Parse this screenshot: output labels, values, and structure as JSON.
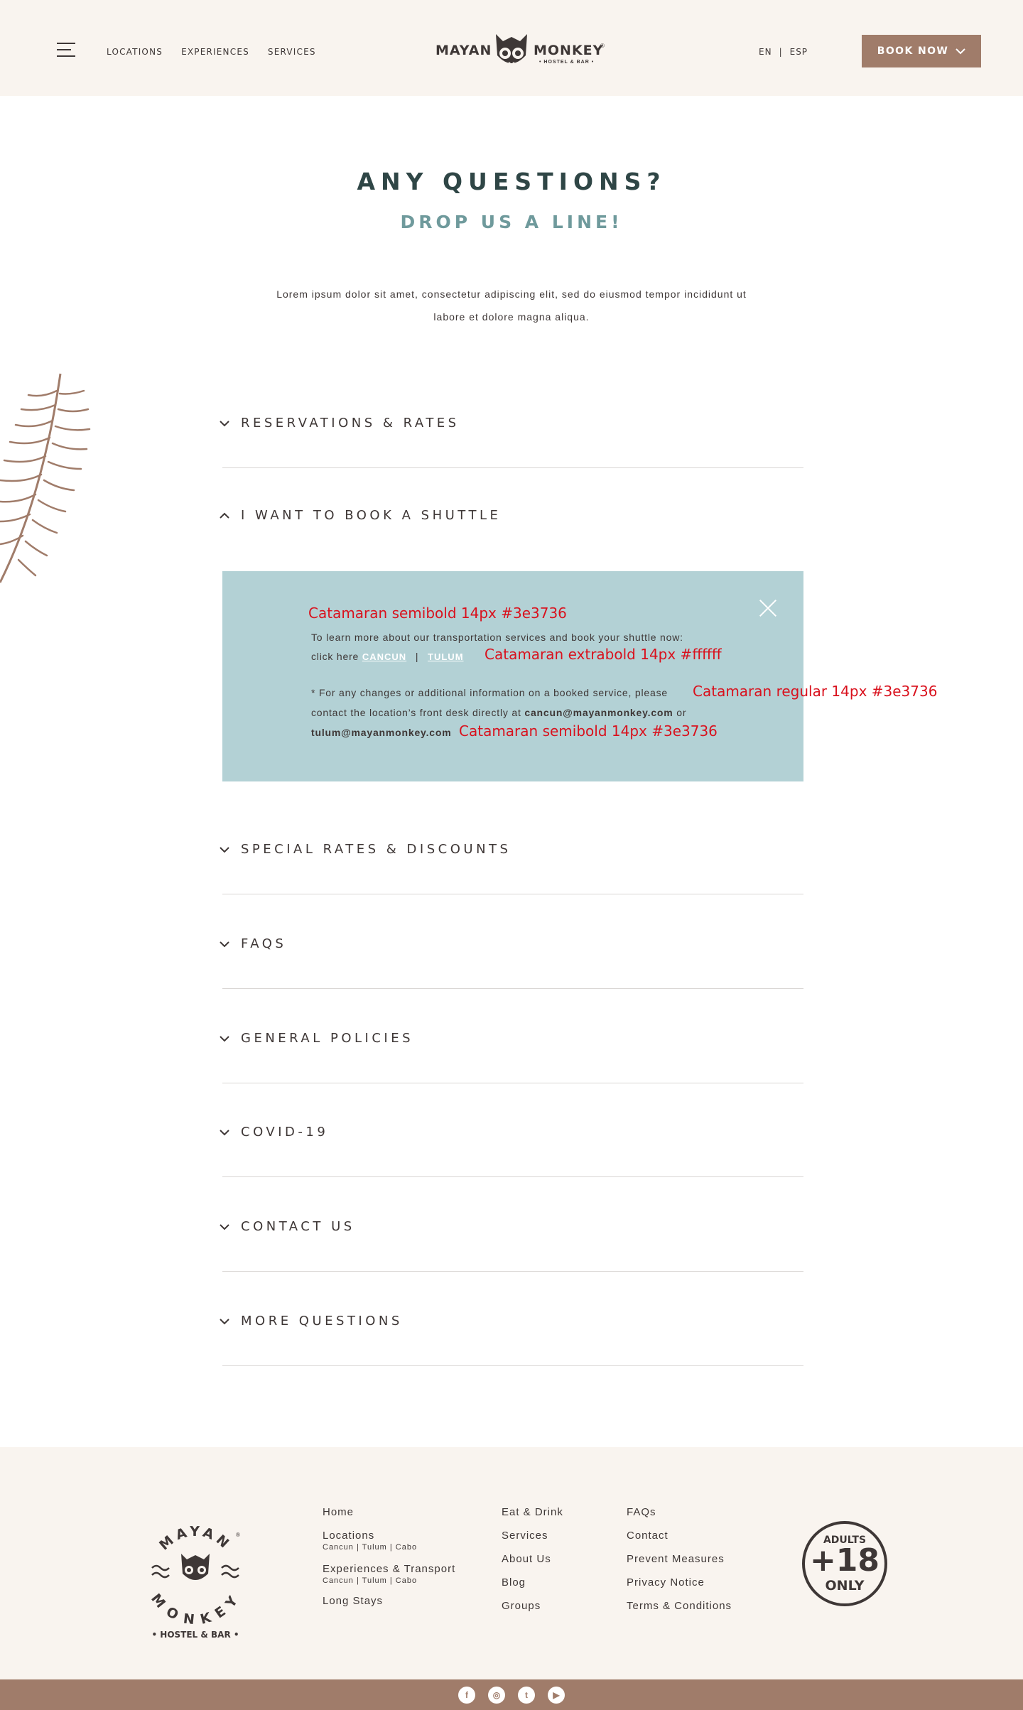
{
  "header": {
    "nav": [
      "LOCATIONS",
      "EXPERIENCES",
      "SERVICES"
    ],
    "logo": {
      "word1": "MAYAN",
      "word2": "MONKEY",
      "sub": "• HOSTEL & BAR •",
      "reg": "®"
    },
    "lang_en": "EN",
    "lang_sep": "|",
    "lang_esp": "ESP",
    "book_label": "BOOK NOW"
  },
  "intro": {
    "title": "ANY QUESTIONS?",
    "subtitle": "DROP US A LINE!",
    "text": "Lorem ipsum dolor sit amet, consectetur adipiscing elit, sed do eiusmod tempor incididunt ut labore et dolore magna aliqua."
  },
  "accordion": [
    {
      "label": "RESERVATIONS & RATES",
      "open": false
    },
    {
      "label": "I WANT TO BOOK A SHUTTLE",
      "open": true
    },
    {
      "label": "SPECIAL RATES & DISCOUNTS",
      "open": false
    },
    {
      "label": "FAQS",
      "open": false
    },
    {
      "label": "GENERAL POLICIES",
      "open": false
    },
    {
      "label": "COVID-19",
      "open": false
    },
    {
      "label": "CONTACT US",
      "open": false
    },
    {
      "label": "MORE QUESTIONS",
      "open": false
    }
  ],
  "panel": {
    "line1": "To learn more about our transportation services and book your shuttle now:",
    "line2_prefix": "click here",
    "link_cancun": "CANCUN",
    "link_sep": "|",
    "link_tulum": "TULUM",
    "line3": "* For any changes or additional information on a booked service, please",
    "line4_prefix": "contact the location’s front desk directly at",
    "email_cancun": "cancun@mayanmonkey.com",
    "line4_suffix": "or",
    "email_tulum": "tulum@mayanmonkey.com",
    "notes": {
      "n1": "Catamaran semibold 14px #3e3736",
      "n2": "Catamaran extrabold 14px #ffffff",
      "n3": "Catamaran regular 14px #3e3736",
      "n4": "Catamaran semibold 14px #3e3736"
    }
  },
  "footer": {
    "logo": {
      "top": "MAYAN",
      "bottom": "MONKEY",
      "sub": "• HOSTEL & BAR •",
      "reg": "®"
    },
    "col1": {
      "home": "Home",
      "locations": "Locations",
      "locations_sub": "Cancun | Tulum | Cabo",
      "experiences": "Experiences & Transport",
      "experiences_sub": "Cancun | Tulum | Cabo",
      "long_stays": "Long Stays"
    },
    "col2": [
      "Eat & Drink",
      "Services",
      "About Us",
      "Blog",
      "Groups"
    ],
    "col3": [
      "FAQs",
      "Contact",
      "Prevent Measures",
      "Privacy Notice",
      "Terms & Conditions"
    ],
    "badge": {
      "line1": "ADULTS",
      "line2": "+18",
      "line3": "ONLY"
    }
  },
  "social": [
    "facebook-icon",
    "instagram-icon",
    "twitter-icon",
    "youtube-icon"
  ],
  "colors": {
    "brand": "#a07c6a",
    "panel": "#b3d1d5",
    "text": "#3e3736",
    "teal": "#6f9a9c",
    "cream": "#f9f4ef",
    "annotation": "#d9111d"
  }
}
